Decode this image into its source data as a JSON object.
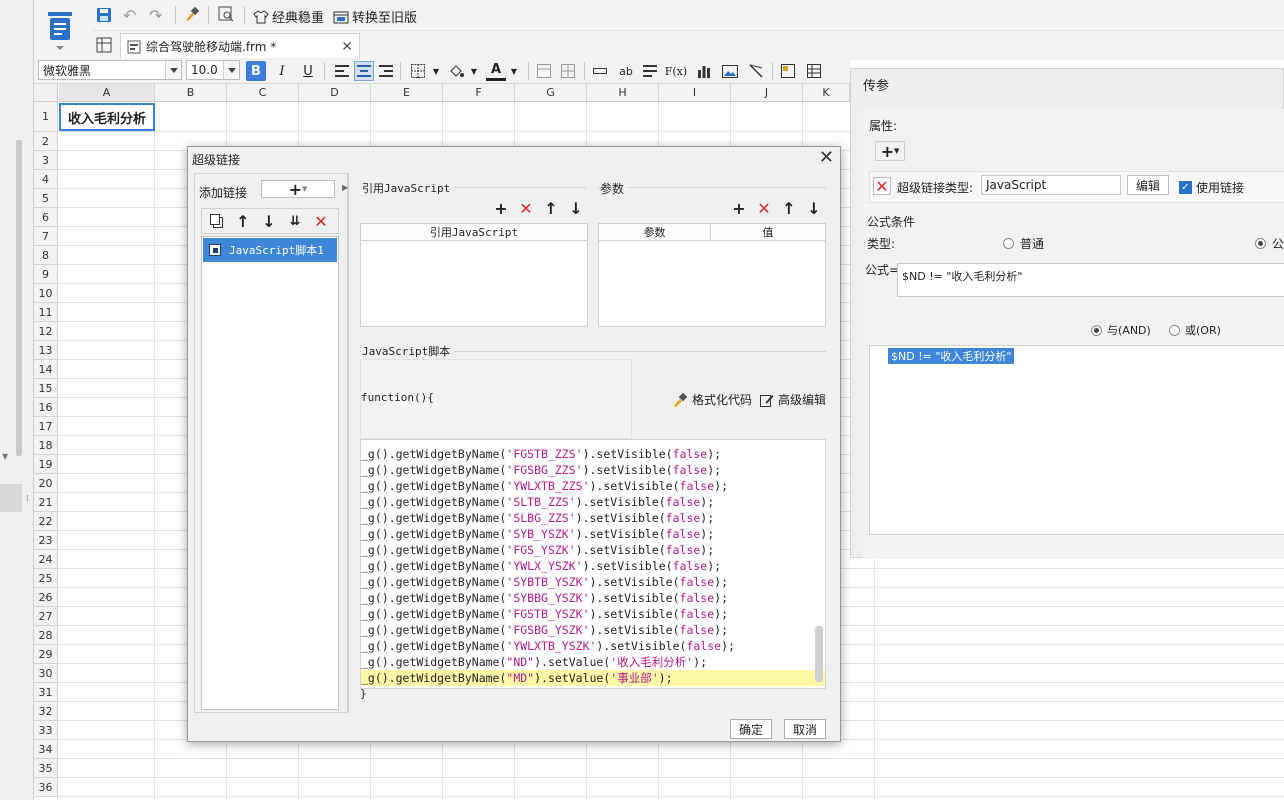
{
  "toolbar": {
    "classic_label": "经典稳重",
    "switch_label": "转换至旧版"
  },
  "file_tab": {
    "name": "综合驾驶舱移动端.frm *"
  },
  "format_bar": {
    "font_name": "微软雅黑",
    "font_size": "10.0"
  },
  "sheet": {
    "columns": [
      "A",
      "B",
      "C",
      "D",
      "E",
      "F",
      "G",
      "H",
      "I",
      "J",
      "K"
    ],
    "rows": [
      "1",
      "2",
      "3",
      "4",
      "5",
      "6",
      "7",
      "8",
      "9",
      "10",
      "11",
      "12",
      "13",
      "14",
      "15",
      "16",
      "17",
      "18",
      "19",
      "20",
      "21",
      "22",
      "23",
      "24",
      "25",
      "26",
      "27",
      "28",
      "29",
      "30",
      "31",
      "32",
      "33",
      "34",
      "35",
      "36"
    ],
    "a1_value": "收入毛利分析"
  },
  "right_panel": {
    "title": "传参",
    "properties_label": "属性:",
    "link_type_label": "超级链接类型:",
    "link_type_value": "JavaScript",
    "edit_button": "编辑",
    "use_link_label": "使用链接",
    "condition_group": "公式条件",
    "type_label": "类型:",
    "type_normal": "普通",
    "type_formula": "公",
    "formula_label": "公式=",
    "formula_value": "$ND != \"收入毛利分析\"",
    "and_label": "与(AND)",
    "or_label": "或(OR)",
    "condition_item": "$ND != \"收入毛利分析\""
  },
  "dialog": {
    "title": "超级链接",
    "add_link_label": "添加链接",
    "list_item": "JavaScript脚本1",
    "ref_js_group": "引用JavaScript",
    "ref_js_col": "引用JavaScript",
    "params_group": "参数",
    "params_col": "参数",
    "value_col": "值",
    "script_group": "JavaScript脚本",
    "function_header": "function(){",
    "format_code": "格式化代码",
    "advanced_edit": "高级编辑",
    "closing_brace": "}",
    "ok": "确定",
    "cancel": "取消",
    "code_lines": [
      {
        "pre": "_g().getWidgetByName(",
        "str": "'FGSTB_ZZS'",
        "mid": ").setVisible(",
        "arg": "false",
        "end": ");"
      },
      {
        "pre": "_g().getWidgetByName(",
        "str": "'FGSBG_ZZS'",
        "mid": ").setVisible(",
        "arg": "false",
        "end": ");"
      },
      {
        "pre": "_g().getWidgetByName(",
        "str": "'YWLXTB_ZZS'",
        "mid": ").setVisible(",
        "arg": "false",
        "end": ");"
      },
      {
        "pre": "_g().getWidgetByName(",
        "str": "'SLTB_ZZS'",
        "mid": ").setVisible(",
        "arg": "false",
        "end": ");"
      },
      {
        "pre": "_g().getWidgetByName(",
        "str": "'SLBG_ZZS'",
        "mid": ").setVisible(",
        "arg": "false",
        "end": ");"
      },
      {
        "pre": "_g().getWidgetByName(",
        "str": "'SYB_YSZK'",
        "mid": ").setVisible(",
        "arg": "false",
        "end": ");"
      },
      {
        "pre": "_g().getWidgetByName(",
        "str": "'FGS_YSZK'",
        "mid": ").setVisible(",
        "arg": "false",
        "end": ");"
      },
      {
        "pre": "_g().getWidgetByName(",
        "str": "'YWLX_YSZK'",
        "mid": ").setVisible(",
        "arg": "false",
        "end": ");"
      },
      {
        "pre": "_g().getWidgetByName(",
        "str": "'SYBTB_YSZK'",
        "mid": ").setVisible(",
        "arg": "false",
        "end": ");"
      },
      {
        "pre": "_g().getWidgetByName(",
        "str": "'SYBBG_YSZK'",
        "mid": ").setVisible(",
        "arg": "false",
        "end": ");"
      },
      {
        "pre": "_g().getWidgetByName(",
        "str": "'FGSTB_YSZK'",
        "mid": ").setVisible(",
        "arg": "false",
        "end": ");"
      },
      {
        "pre": "_g().getWidgetByName(",
        "str": "'FGSBG_YSZK'",
        "mid": ").setVisible(",
        "arg": "false",
        "end": ");"
      },
      {
        "pre": "_g().getWidgetByName(",
        "str": "'YWLXTB_YSZK'",
        "mid": ").setVisible(",
        "arg": "false",
        "end": ");"
      },
      {
        "pre": "_g().getWidgetByName(",
        "str": "\"ND\"",
        "mid": ").setValue(",
        "arg": "'收入毛利分析'",
        "end": ");"
      },
      {
        "pre": "_g().getWidgetByName(",
        "str": "\"MD\"",
        "mid": ").setValue(",
        "arg": "'事业部'",
        "end": ");"
      }
    ]
  }
}
